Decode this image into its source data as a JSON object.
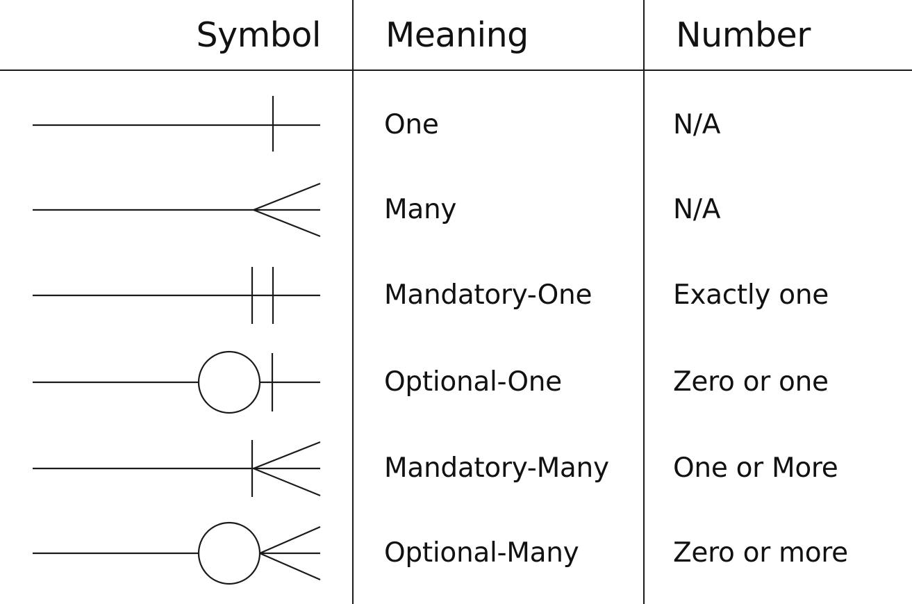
{
  "header": {
    "symbol": "Symbol",
    "meaning": "Meaning",
    "number": "Number"
  },
  "rows": [
    {
      "symbol_icon": "one-icon",
      "meaning": "One",
      "number": "N/A"
    },
    {
      "symbol_icon": "many-icon",
      "meaning": "Many",
      "number": "N/A"
    },
    {
      "symbol_icon": "mandatory-one-icon",
      "meaning": "Mandatory-One",
      "number": "Exactly one"
    },
    {
      "symbol_icon": "optional-one-icon",
      "meaning": "Optional-One",
      "number": "Zero or one"
    },
    {
      "symbol_icon": "mandatory-many-icon",
      "meaning": "Mandatory-Many",
      "number": "One or More"
    },
    {
      "symbol_icon": "optional-many-icon",
      "meaning": "Optional-Many",
      "number": "Zero or more"
    }
  ],
  "colors": {
    "line": "#1a1a1a",
    "background": "#ffffff"
  }
}
